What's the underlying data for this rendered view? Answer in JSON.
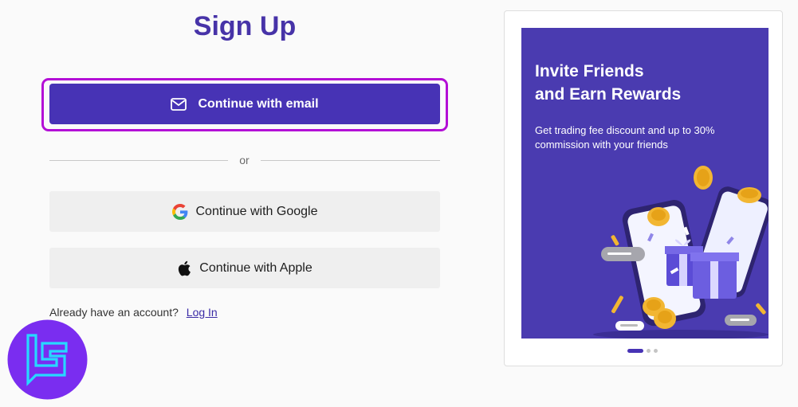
{
  "signup": {
    "title": "Sign Up",
    "email_button": "Continue with email",
    "divider": "or",
    "google_button": "Continue with Google",
    "apple_button": "Continue with Apple",
    "already_text": "Already have an account?",
    "login_link": "Log In"
  },
  "promo": {
    "title_line1": "Invite Friends",
    "title_line2": "and Earn Rewards",
    "subtitle": "Get trading fee discount and up to 30% commission with your friends",
    "carousel": {
      "total": 3,
      "active": 1
    }
  },
  "icons": {
    "email": "mail-icon",
    "google": "google-icon",
    "apple": "apple-icon"
  },
  "colors": {
    "accent": "#4733b5",
    "title": "#4733a8",
    "highlight": "#b30fd6",
    "promo_bg": "#4a3bb0",
    "coin": "#f2b632"
  }
}
